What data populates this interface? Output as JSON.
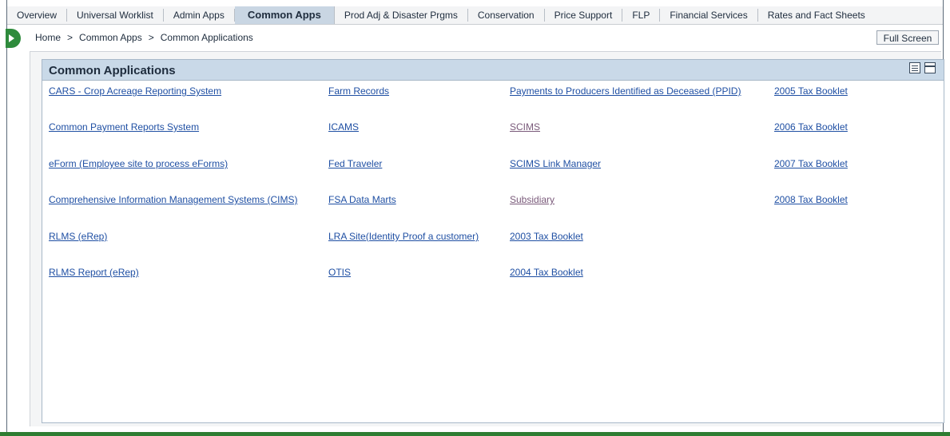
{
  "tabs": [
    {
      "label": "Overview",
      "active": false
    },
    {
      "label": "Universal Worklist",
      "active": false
    },
    {
      "label": "Admin Apps",
      "active": false
    },
    {
      "label": "Common Apps",
      "active": true
    },
    {
      "label": "Prod Adj & Disaster Prgms",
      "active": false
    },
    {
      "label": "Conservation",
      "active": false
    },
    {
      "label": "Price Support",
      "active": false
    },
    {
      "label": "FLP",
      "active": false
    },
    {
      "label": "Financial Services",
      "active": false
    },
    {
      "label": "Rates and Fact Sheets",
      "active": false
    }
  ],
  "breadcrumb": {
    "items": [
      "Home",
      "Common Apps",
      "Common Applications"
    ],
    "separator": ">"
  },
  "full_screen_label": "Full Screen",
  "panel": {
    "title": "Common Applications",
    "columns": [
      [
        "CARS - Crop Acreage Reporting System",
        "Common Payment Reports System",
        "eForm (Employee site to process eForms)",
        "Comprehensive Information Management Systems (CIMS)",
        "RLMS (eRep)",
        "RLMS Report (eRep)"
      ],
      [
        "Farm Records",
        "ICAMS",
        "Fed Traveler",
        "FSA Data Marts",
        "LRA Site(Identity Proof a customer)",
        "OTIS"
      ],
      [
        "Payments to Producers Identified as Deceased (PPID)",
        "SCIMS",
        "SCIMS Link Manager",
        "Subsidiary",
        "2003 Tax Booklet",
        "2004 Tax Booklet"
      ],
      [
        "2005 Tax Booklet",
        "2006 Tax Booklet",
        "2007 Tax Booklet",
        "2008 Tax Booklet"
      ]
    ],
    "visited_links": [
      "SCIMS",
      "Subsidiary"
    ]
  },
  "colors": {
    "link": "#1f4fa3",
    "visited": "#7a5a7a",
    "header_bg": "#c9d9e8",
    "nav_green": "#2e8b3c"
  }
}
